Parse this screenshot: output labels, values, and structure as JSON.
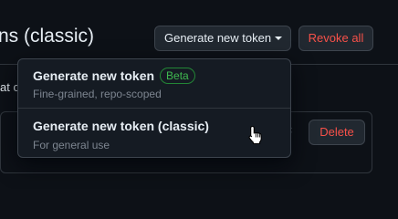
{
  "header": {
    "title": "ns (classic)",
    "generate_button_label": "Generate new token",
    "revoke_button_label": "Revoke all"
  },
  "content": {
    "description_fragment": "at c",
    "token_row_x": "×",
    "delete_button_label": "Delete"
  },
  "dropdown": {
    "items": [
      {
        "label": "Generate new token",
        "badge": "Beta",
        "description": "Fine-grained, repo-scoped"
      },
      {
        "label": "Generate new token (classic)",
        "description": "For general use"
      }
    ]
  },
  "icons": {
    "caret": "triangle-down-icon",
    "cursor": "hand-pointer-icon"
  },
  "colors": {
    "background": "#0d1117",
    "danger": "#f85149",
    "success": "#3fb950",
    "border": "#30363d",
    "muted": "#7d8590"
  }
}
